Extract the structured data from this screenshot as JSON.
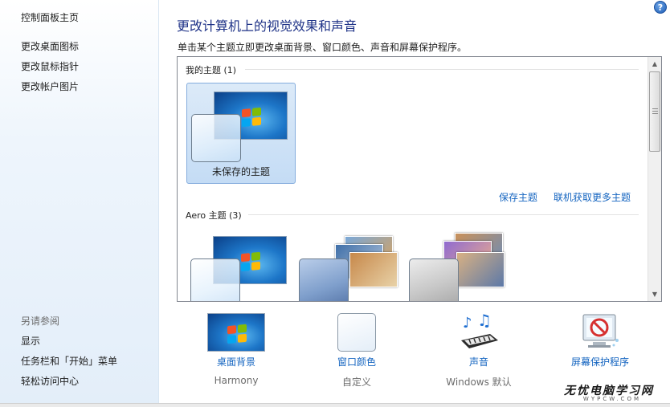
{
  "nav": {
    "home": "控制面板主页",
    "links": [
      "更改桌面图标",
      "更改鼠标指针",
      "更改帐户图片"
    ],
    "see_also_heading": "另请参阅",
    "see_also": [
      "显示",
      "任务栏和「开始」菜单",
      "轻松访问中心"
    ]
  },
  "help_icon": "?",
  "main": {
    "title": "更改计算机上的视觉效果和声音",
    "subtitle": "单击某个主题立即更改桌面背景、窗口颜色、声音和屏幕保护程序。"
  },
  "themes": {
    "my_group": {
      "name": "我的主题 (1)",
      "items": [
        {
          "label": "未保存的主题",
          "selected": true
        }
      ]
    },
    "save_link": "保存主题",
    "online_link": "联机获取更多主题",
    "aero_group": {
      "name": "Aero 主题 (3)"
    }
  },
  "quick": [
    {
      "label": "桌面背景",
      "value": "Harmony",
      "icon": "wallpaper-icon"
    },
    {
      "label": "窗口颜色",
      "value": "自定义",
      "icon": "window-color-icon"
    },
    {
      "label": "声音",
      "value": "Windows 默认",
      "icon": "sound-icon"
    },
    {
      "label": "屏幕保护程序",
      "value": "",
      "icon": "screensaver-icon"
    }
  ],
  "watermark": {
    "text": "无忧电脑学习网",
    "sub": "WYPCW.COM"
  },
  "colors": {
    "link": "#1565c0",
    "title": "#1e3287",
    "selection": "#c4dcf5"
  }
}
